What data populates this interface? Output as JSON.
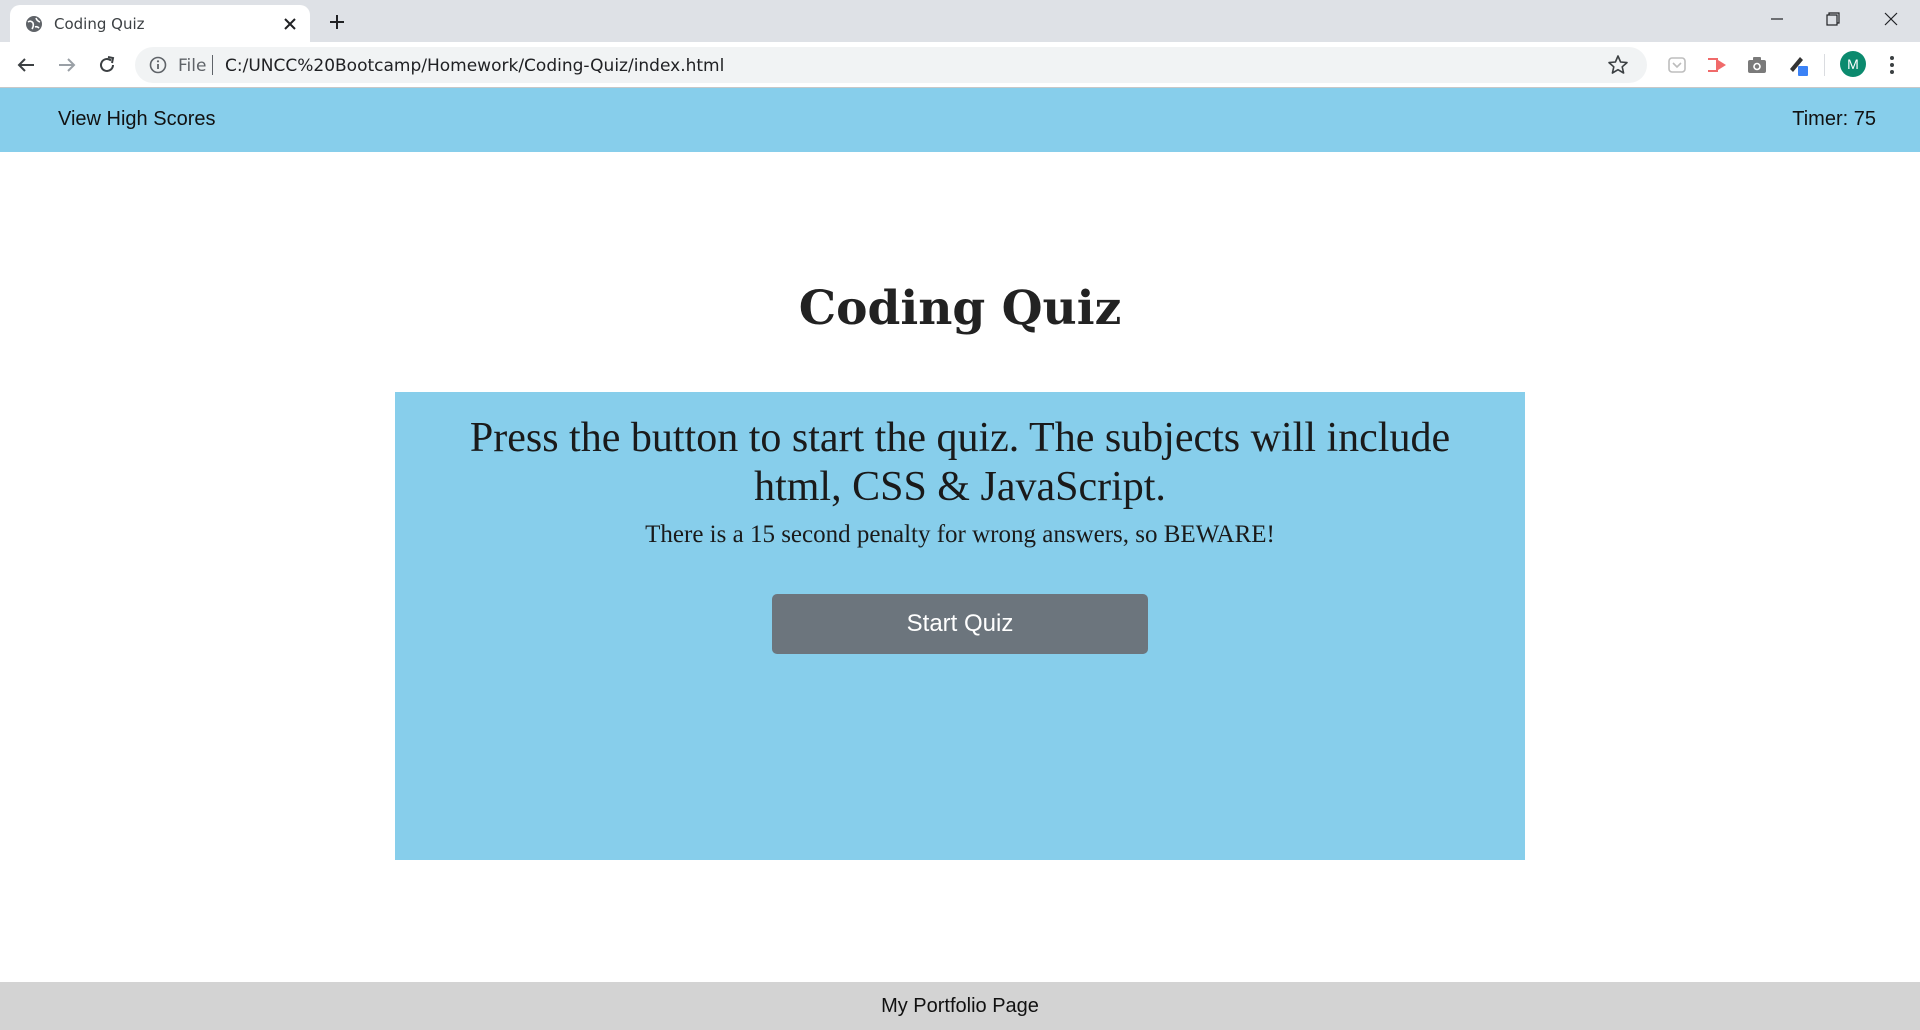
{
  "browser": {
    "tab_title": "Coding Quiz",
    "omnibox_scheme_label": "File",
    "url": "C:/UNCC%20Bootcamp/Homework/Coding-Quiz/index.html",
    "profile_initial": "M"
  },
  "header": {
    "high_scores_link": "View High Scores",
    "timer_text": "Timer: 75"
  },
  "main": {
    "title": "Coding Quiz",
    "intro_heading": "Press the button to start the quiz. The subjects will include html, CSS & JavaScript.",
    "penalty_text": "There is a 15 second penalty for wrong answers, so BEWARE!",
    "start_button_label": "Start Quiz"
  },
  "footer": {
    "portfolio_link": "My Portfolio Page"
  },
  "colors": {
    "accent": "#87ceeb",
    "button": "#6c757d",
    "footer": "#d3d3d3"
  },
  "icons": [
    "globe-icon",
    "close-icon",
    "plus-icon",
    "minimize-icon",
    "restore-icon",
    "window-close-icon",
    "back-arrow-icon",
    "forward-arrow-icon",
    "reload-icon",
    "info-icon",
    "star-icon",
    "pocket-icon",
    "cast-icon",
    "camera-icon",
    "pen-icon",
    "more-vert-icon"
  ]
}
